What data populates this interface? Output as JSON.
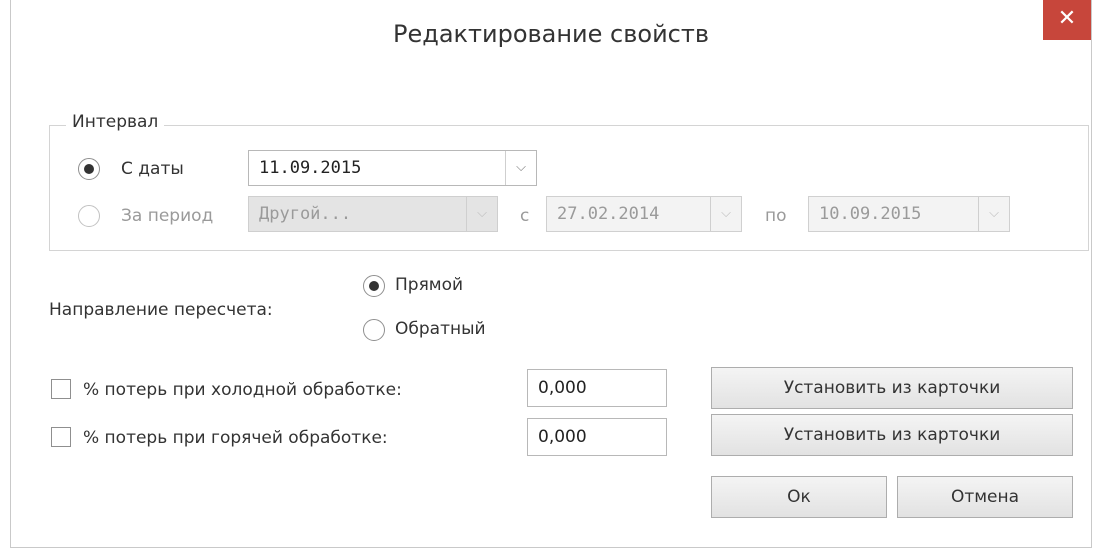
{
  "window": {
    "title": "Редактирование свойств",
    "close_glyph": "✕"
  },
  "interval": {
    "legend": "Интервал",
    "from_date": {
      "label": "С даты",
      "selected": true,
      "value": "11.09.2015"
    },
    "period": {
      "label": "За период",
      "selected": false,
      "preset": "Другой...",
      "from_label": "с",
      "from_value": "27.02.2014",
      "to_label": "по",
      "to_value": "10.09.2015"
    }
  },
  "direction": {
    "label": "Направление пересчета:",
    "options": [
      {
        "label": "Прямой",
        "selected": true
      },
      {
        "label": "Обратный",
        "selected": false
      }
    ]
  },
  "losses": [
    {
      "label": "% потерь при холодной обработке:",
      "checked": false,
      "value": "0,000",
      "button": "Установить из карточки"
    },
    {
      "label": "% потерь при горячей обработке:",
      "checked": false,
      "value": "0,000",
      "button": "Установить из карточки"
    }
  ],
  "buttons": {
    "ok": "Ок",
    "cancel": "Отмена"
  },
  "icons": {
    "dropdown": "chevron-down-icon",
    "close": "close-icon"
  },
  "colors": {
    "close_bg": "#c7463b"
  }
}
